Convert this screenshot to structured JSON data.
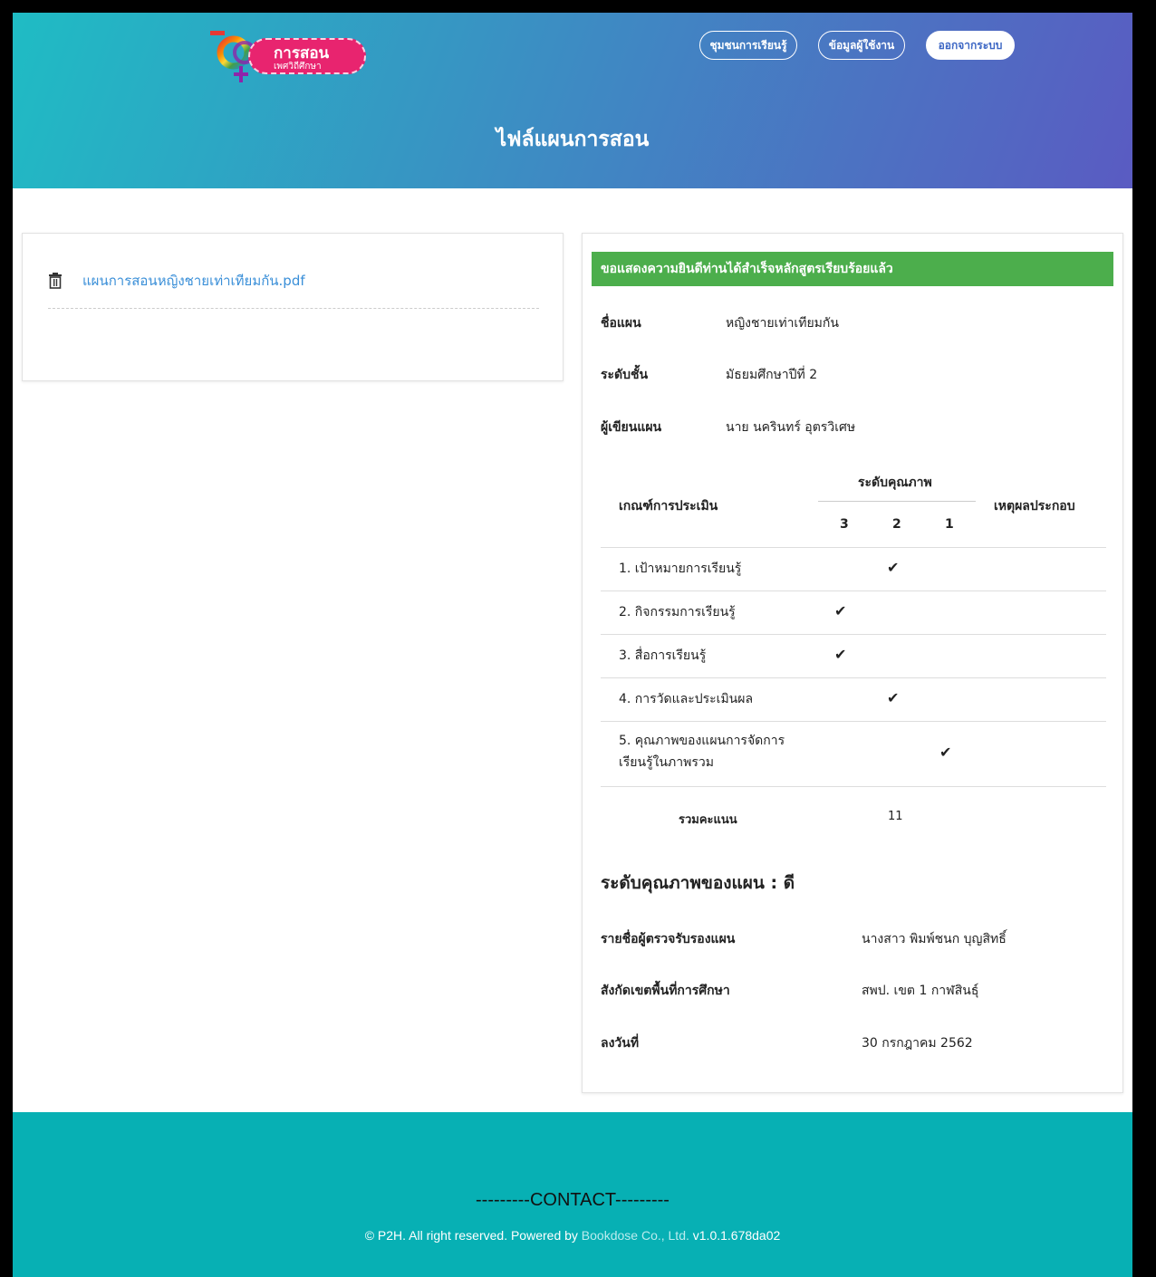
{
  "header": {
    "logo_line1": "การสอน",
    "logo_line2": "เพศวิถีศึกษา",
    "nav": {
      "community": "ชุมชนการเรียนรู้",
      "profile": "ข้อมูลผู้ใช้งาน",
      "logout": "ออกจากระบบ"
    },
    "page_title": "ไฟล์แผนการสอน"
  },
  "file_card": {
    "file_name": "แผนการสอนหญิงชายเท่าเทียมกัน.pdf",
    "icon": "trash-icon"
  },
  "evaluation": {
    "banner": "ขอแสดงความยินดีท่านได้สำเร็จหลักสูตรเรียบร้อยแล้ว",
    "plan_name_label": "ชื่อแผน",
    "plan_name": "หญิงชายเท่าเทียมกัน",
    "grade_label": "ระดับชั้น",
    "grade": "มัธยมศึกษาปีที่ 2",
    "author_label": "ผู้เขียนแผน",
    "author": "นาย นครินทร์ อุตรวิเศษ",
    "table": {
      "criteria_header": "เกณฑ์การประเมิน",
      "quality_header": "ระดับคุณภาพ",
      "levels": [
        "3",
        "2",
        "1"
      ],
      "reason_header": "เหตุผลประกอบ",
      "rows": [
        {
          "label": "1. เป้าหมายการเรียนรู้",
          "level": 2
        },
        {
          "label": "2. กิจกรรมการเรียนรู้",
          "level": 3
        },
        {
          "label": "3. สื่อการเรียนรู้",
          "level": 3
        },
        {
          "label": "4. การวัดและประเมินผล",
          "level": 2
        },
        {
          "label": "5. คุณภาพของแผนการจัดการเรียนรู้ในภาพรวม",
          "level": 1
        }
      ],
      "total_label": "รวมคะแนน",
      "total_value": "11"
    },
    "quality_summary": "ระดับคุณภาพของแผน : ดี",
    "certifier_label": "รายชื่อผู้ตรวจรับรองแผน",
    "certifier": "นางสาว พิมพ์ชนก บุญสิทธิ์",
    "area_label": "สังกัดเขตพื้นที่การศึกษา",
    "area": "สพป. เขต 1 กาฬสินธุ์",
    "date_label": "ลงวันที่",
    "date": "30 กรกฎาคม 2562"
  },
  "footer": {
    "contact_title": "---------CONTACT---------",
    "copyright_prefix": "© P2H. All right reserved. Powered by ",
    "copyright_link": "Bookdose Co., Ltd.",
    "version": " v1.0.1.678da02"
  },
  "colors": {
    "success": "#4cae4c",
    "footer": "#07b0b4",
    "link": "#3a8fd8"
  }
}
